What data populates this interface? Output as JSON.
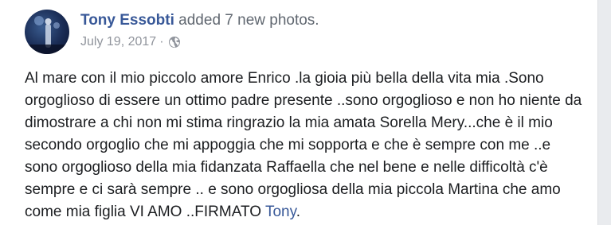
{
  "post": {
    "author": "Tony Essobti",
    "action": "added 7 new photos.",
    "date": "July 19, 2017",
    "separator": "·",
    "privacy_icon": "globe-icon",
    "body": "Al mare con il mio piccolo amore Enrico .la gioia più bella della vita mia .Sono orgoglioso di essere un ottimo padre presente ..sono orgoglioso e non ho niente da dimostrare a chi non mi stima ringrazio la mia amata Sorella Mery...che è il mio secondo orgoglio che mi appoggia che mi sopporta e che è sempre con me ..e sono orgoglioso della mia fidanzata Raffaella che nel bene e nelle difficoltà c'è sempre e ci sarà sempre .. e sono orgogliosa della mia piccola Martina che amo come mia figlia VI AMO ..FIRMATO ",
    "tagged_name": "Tony",
    "end_punct": "."
  },
  "colors": {
    "link": "#385898",
    "meta": "#90949c",
    "text": "#1c1e21"
  }
}
